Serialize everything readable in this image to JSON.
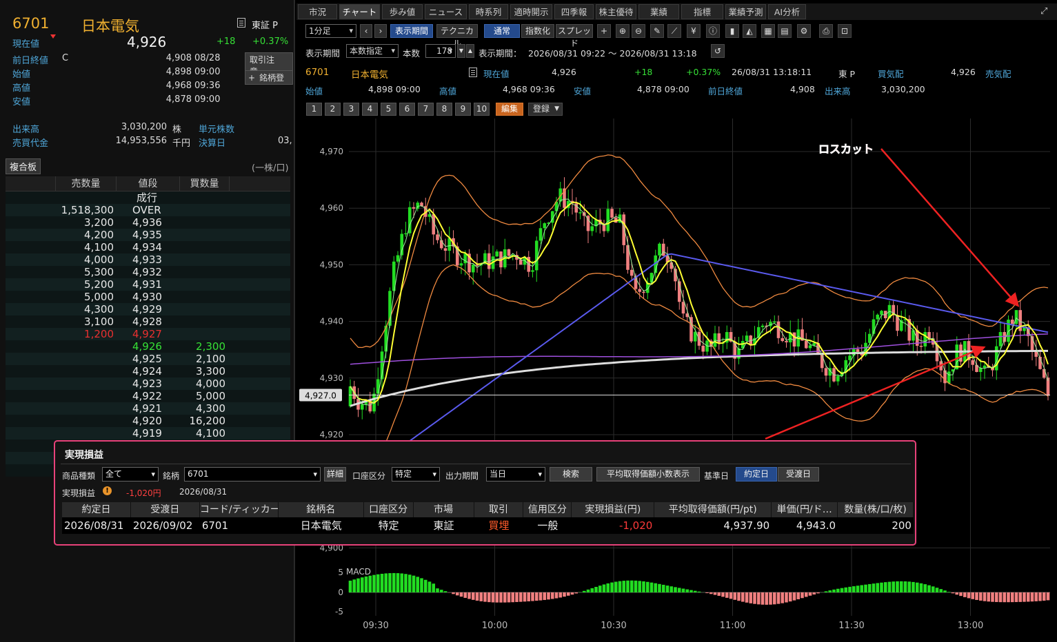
{
  "left_panel": {
    "code": "6701",
    "name": "日本電気",
    "market": "東証 P",
    "current": {
      "label": "現在値",
      "value": "4,926",
      "change": "+18",
      "change_pct": "+0.37%"
    },
    "side_buttons": [
      "取引注意・",
      "銘柄登"
    ],
    "quotes": [
      {
        "label": "前日終値",
        "mark": "C",
        "value": "4,908",
        "time": "08/28"
      },
      {
        "label": "始値",
        "mark": "",
        "value": "4,898",
        "time": "09:00"
      },
      {
        "label": "高値",
        "mark": "",
        "value": "4,968",
        "time": "09:36"
      },
      {
        "label": "安値",
        "mark": "",
        "value": "4,878",
        "time": "09:00"
      }
    ],
    "volume": {
      "label": "出来高",
      "value": "3,030,200",
      "unit": "株",
      "label2": "単元株数",
      "value2": ""
    },
    "turnover": {
      "label": "売買代金",
      "value": "14,953,556",
      "unit": "千円",
      "label2": "決算日",
      "value2": "03,"
    },
    "board_tab": "複合板",
    "unit_note": "(一株/口)",
    "board_headers": [
      "売数量",
      "値段",
      "買数量"
    ],
    "board_rows": [
      {
        "sell": "",
        "price": "成行",
        "buy": "",
        "color": "#e8e8e8"
      },
      {
        "sell": "1,518,300",
        "price": "OVER",
        "buy": "",
        "color": "#e8e8e8"
      },
      {
        "sell": "3,200",
        "price": "4,936",
        "buy": "",
        "color": "#e8e8e8"
      },
      {
        "sell": "4,200",
        "price": "4,935",
        "buy": "",
        "color": "#e8e8e8"
      },
      {
        "sell": "4,100",
        "price": "4,934",
        "buy": "",
        "color": "#e8e8e8"
      },
      {
        "sell": "4,000",
        "price": "4,933",
        "buy": "",
        "color": "#e8e8e8"
      },
      {
        "sell": "5,300",
        "price": "4,932",
        "buy": "",
        "color": "#e8e8e8"
      },
      {
        "sell": "5,200",
        "price": "4,931",
        "buy": "",
        "color": "#e8e8e8"
      },
      {
        "sell": "5,000",
        "price": "4,930",
        "buy": "",
        "color": "#e8e8e8"
      },
      {
        "sell": "4,300",
        "price": "4,929",
        "buy": "",
        "color": "#e8e8e8"
      },
      {
        "sell": "3,100",
        "price": "4,928",
        "buy": "",
        "color": "#e8e8e8"
      },
      {
        "sell": "1,200",
        "price": "4,927",
        "buy": "",
        "color": "#e83030"
      },
      {
        "sell": "",
        "price": "4,926",
        "buy": "2,300",
        "color": "#36e036"
      },
      {
        "sell": "",
        "price": "4,925",
        "buy": "2,100",
        "color": "#e8e8e8"
      },
      {
        "sell": "",
        "price": "4,924",
        "buy": "3,300",
        "color": "#e8e8e8"
      },
      {
        "sell": "",
        "price": "4,923",
        "buy": "4,000",
        "color": "#e8e8e8"
      },
      {
        "sell": "",
        "price": "4,922",
        "buy": "5,000",
        "color": "#e8e8e8"
      },
      {
        "sell": "",
        "price": "4,921",
        "buy": "4,300",
        "color": "#e8e8e8"
      },
      {
        "sell": "",
        "price": "4,920",
        "buy": "16,200",
        "color": "#e8e8e8"
      },
      {
        "sell": "",
        "price": "4,919",
        "buy": "4,100",
        "color": "#e8e8e8"
      }
    ]
  },
  "tabs": [
    "市況",
    "チャート",
    "歩み値",
    "ニュース",
    "時系列",
    "適時開示",
    "四季報",
    "株主優待",
    "業績",
    "指標",
    "業績予測",
    "AI分析"
  ],
  "active_tab": 1,
  "toolbar": {
    "interval": "1分足",
    "period_button": "表示期間",
    "technical_button": "テクニカル",
    "normal_button": "通常",
    "index_button": "指数化",
    "spread_button": "スプレッド"
  },
  "period_row": {
    "label": "表示期間",
    "mode": "本数指定",
    "count_label": "本数",
    "count": "178",
    "range_label": "表示期間：",
    "range": "2026/08/31 09:22 ～ 2026/08/31 13:18"
  },
  "info": {
    "code": "6701",
    "name": "日本電気",
    "cur_label": "現在値",
    "cur": "4,926",
    "chg": "+18",
    "pct": "+0.37%",
    "datetime": "26/08/31 13:18:11",
    "market": "東 P",
    "bid_label": "買気配",
    "bid": "4,926",
    "ask_label": "売気配",
    "open_label": "始値",
    "open": "4,898 09:00",
    "high_label": "高値",
    "high": "4,968 09:36",
    "low_label": "安値",
    "low": "4,878 09:00",
    "prev_label": "前日終値",
    "prev": "4,908",
    "vol_label": "出来高",
    "vol": "3,030,200"
  },
  "number_buttons": [
    "1",
    "2",
    "3",
    "4",
    "5",
    "6",
    "7",
    "8",
    "9",
    "10"
  ],
  "edit_button": "編集",
  "register_button": "登録",
  "chart_data": {
    "type": "candlestick",
    "x_ticks": [
      "09:30",
      "10:00",
      "10:30",
      "11:00",
      "11:30",
      "13:00"
    ],
    "y_ticks": [
      4970,
      4960,
      4950,
      4940,
      4930,
      4920,
      4900
    ],
    "price_marker": "4,927.0",
    "annotation": "ロスカット",
    "macd_label": "MACD",
    "macd_ticks": [
      "5",
      "0",
      "-5"
    ],
    "colors": {
      "up": "#22dd22",
      "down": "#f08080",
      "ma_short": "#ffff33",
      "ma_mid": "#5a5aee",
      "ma_long": "#dddddd",
      "vwap": "#a050e0",
      "bands": "#f08a40",
      "arrow": "#ee2222"
    }
  },
  "pnl": {
    "title": "実現損益",
    "filters": {
      "product_label": "商品種類",
      "product": "全て",
      "symbol_label": "銘柄",
      "symbol": "6701",
      "detail_button": "詳細",
      "account_label": "口座区分",
      "account": "特定",
      "period_label": "出力期間",
      "period": "当日",
      "search_button": "検索",
      "decimal_button": "平均取得価額小数表示",
      "base_label": "基準日",
      "base_on": "約定日",
      "base_off": "受渡日"
    },
    "summary": {
      "label": "実現損益",
      "value": "-1,020円",
      "date": "2026/08/31"
    },
    "headers": [
      "約定日",
      "受渡日",
      "コード/ティッカー",
      "銘柄名",
      "口座区分",
      "市場",
      "取引",
      "信用区分",
      "実現損益(円)",
      "平均取得価額(円/pt)",
      "単価(円/ド…",
      "数量(株/口/枚)"
    ],
    "rows": [
      [
        "2026/08/31",
        "2026/09/02",
        "6701",
        "日本電気",
        "特定",
        "東証",
        "買埋",
        "一般",
        "-1,020",
        "4,937.90",
        "4,943.0",
        "200"
      ]
    ]
  }
}
